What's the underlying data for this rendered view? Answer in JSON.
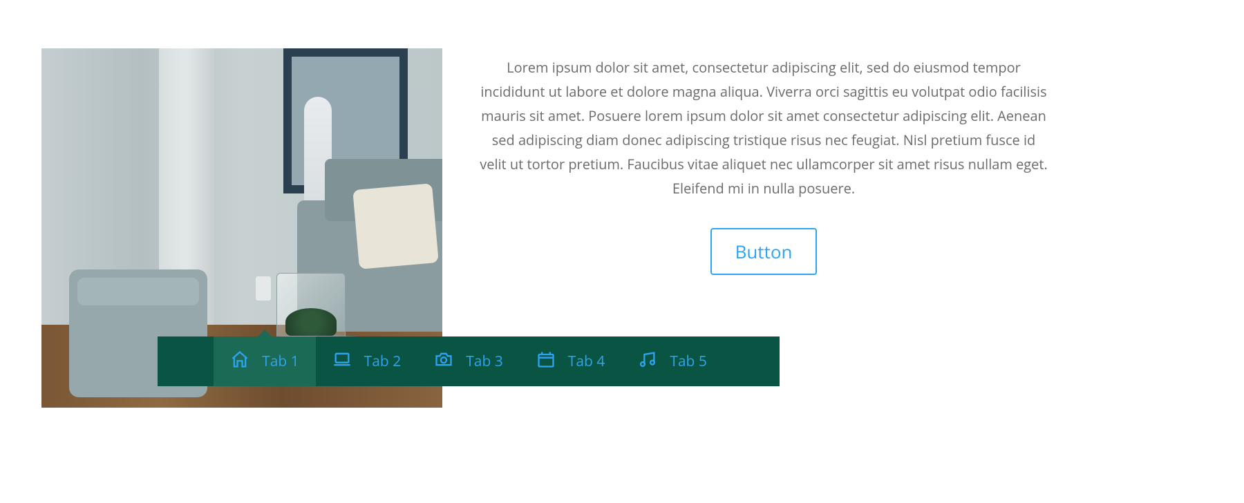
{
  "content": {
    "paragraph": "Lorem ipsum dolor sit amet, consectetur adipiscing elit, sed do eiusmod tempor incididunt ut labore et dolore magna aliqua. Viverra orci sagittis eu volutpat odio facilisis mauris sit amet. Posuere lorem ipsum dolor sit amet consectetur adipiscing elit. Aenean sed adipiscing diam donec adipiscing tristique risus nec feugiat. Nisl pretium fusce id velit ut tortor pretium. Faucibus vitae aliquet nec ullamcorper sit amet risus nullam eget. Eleifend mi in nulla posuere.",
    "button_label": "Button"
  },
  "tabs": {
    "items": [
      {
        "label": "Tab 1",
        "icon": "home-icon",
        "active": true
      },
      {
        "label": "Tab 2",
        "icon": "laptop-icon",
        "active": false
      },
      {
        "label": "Tab 3",
        "icon": "camera-icon",
        "active": false
      },
      {
        "label": "Tab 4",
        "icon": "calendar-icon",
        "active": false
      },
      {
        "label": "Tab 5",
        "icon": "music-icon",
        "active": false
      }
    ]
  },
  "colors": {
    "accent": "#2ea3f2",
    "tab_bg": "#0a5444",
    "tab_active_bg": "#1a6a56",
    "text": "#6b6b6b"
  },
  "image": {
    "description": "interior-room-photo"
  }
}
